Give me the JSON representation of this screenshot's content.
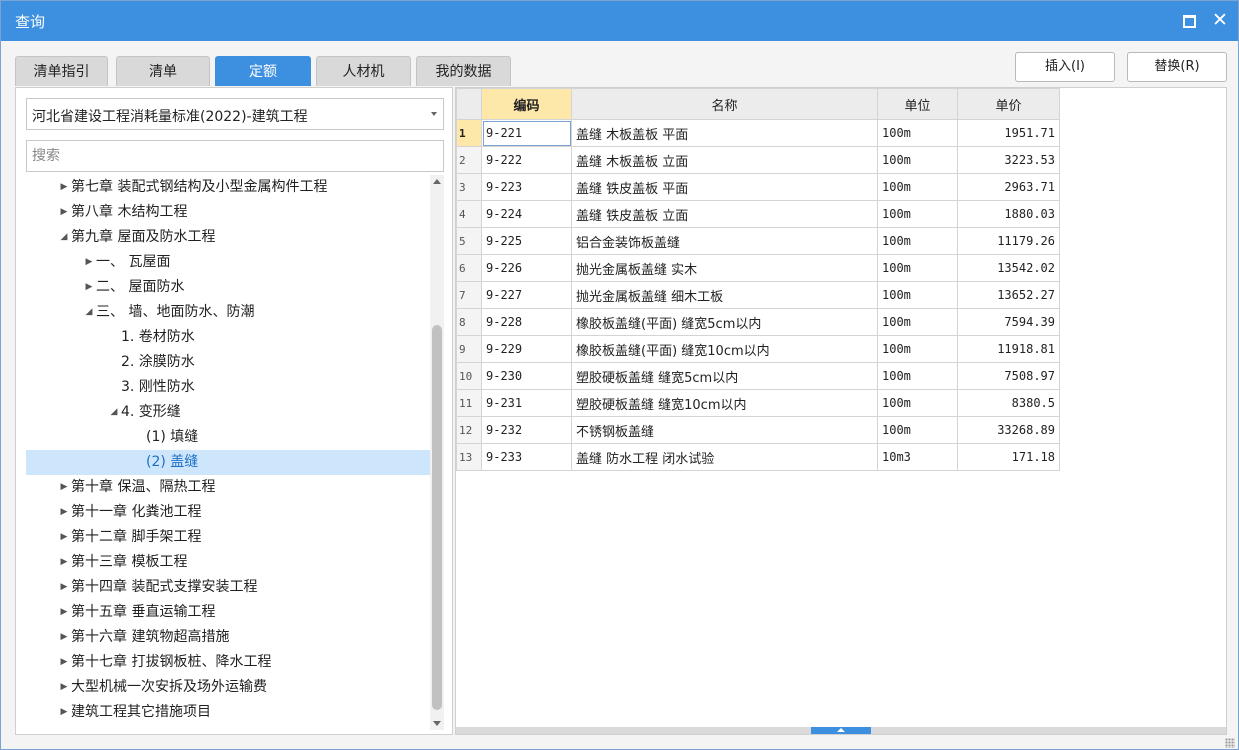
{
  "window": {
    "title": "查询"
  },
  "tabs": [
    {
      "label": "清单指引",
      "active": false
    },
    {
      "label": "清单",
      "active": false
    },
    {
      "label": "定额",
      "active": true
    },
    {
      "label": "人材机",
      "active": false
    },
    {
      "label": "我的数据",
      "active": false
    }
  ],
  "actions": {
    "insert_label": "插入(I)",
    "replace_label": "替换(R)"
  },
  "library": {
    "selected": "河北省建设工程消耗量标准(2022)-建筑工程"
  },
  "search": {
    "placeholder": "搜索",
    "value": ""
  },
  "tree": [
    {
      "label": "第七章 装配式钢结构及小型金属构件工程",
      "level": 0,
      "state": "collapsed",
      "selected": false
    },
    {
      "label": "第八章 木结构工程",
      "level": 0,
      "state": "collapsed",
      "selected": false
    },
    {
      "label": "第九章 屋面及防水工程",
      "level": 0,
      "state": "expanded",
      "selected": false
    },
    {
      "label": "一、 瓦屋面",
      "level": 1,
      "state": "collapsed",
      "selected": false
    },
    {
      "label": "二、 屋面防水",
      "level": 1,
      "state": "collapsed",
      "selected": false
    },
    {
      "label": "三、 墙、地面防水、防潮",
      "level": 1,
      "state": "expanded",
      "selected": false
    },
    {
      "label": "1. 卷材防水",
      "level": 2,
      "state": "leaf",
      "selected": false
    },
    {
      "label": "2. 涂膜防水",
      "level": 2,
      "state": "leaf",
      "selected": false
    },
    {
      "label": "3. 刚性防水",
      "level": 2,
      "state": "leaf",
      "selected": false
    },
    {
      "label": "4. 变形缝",
      "level": 2,
      "state": "expanded",
      "selected": false
    },
    {
      "label": "(1) 填缝",
      "level": 3,
      "state": "leaf",
      "selected": false
    },
    {
      "label": "(2) 盖缝",
      "level": 3,
      "state": "leaf",
      "selected": true
    },
    {
      "label": "第十章 保温、隔热工程",
      "level": 0,
      "state": "collapsed",
      "selected": false
    },
    {
      "label": "第十一章 化粪池工程",
      "level": 0,
      "state": "collapsed",
      "selected": false
    },
    {
      "label": "第十二章 脚手架工程",
      "level": 0,
      "state": "collapsed",
      "selected": false
    },
    {
      "label": "第十三章 模板工程",
      "level": 0,
      "state": "collapsed",
      "selected": false
    },
    {
      "label": "第十四章 装配式支撑安装工程",
      "level": 0,
      "state": "collapsed",
      "selected": false
    },
    {
      "label": "第十五章 垂直运输工程",
      "level": 0,
      "state": "collapsed",
      "selected": false
    },
    {
      "label": "第十六章 建筑物超高措施",
      "level": 0,
      "state": "collapsed",
      "selected": false
    },
    {
      "label": "第十七章 打拔钢板桩、降水工程",
      "level": 0,
      "state": "collapsed",
      "selected": false
    },
    {
      "label": "大型机械一次安拆及场外运输费",
      "level": 0,
      "state": "collapsed",
      "selected": false
    },
    {
      "label": "建筑工程其它措施项目",
      "level": 0,
      "state": "collapsed",
      "selected": false
    }
  ],
  "table": {
    "columns": [
      "编码",
      "名称",
      "单位",
      "单价"
    ],
    "rows": [
      {
        "idx": "1",
        "code": "9-221",
        "name": "盖缝 木板盖板 平面",
        "unit": "100m",
        "price": "1951.71"
      },
      {
        "idx": "2",
        "code": "9-222",
        "name": "盖缝 木板盖板 立面",
        "unit": "100m",
        "price": "3223.53"
      },
      {
        "idx": "3",
        "code": "9-223",
        "name": "盖缝 铁皮盖板 平面",
        "unit": "100m",
        "price": "2963.71"
      },
      {
        "idx": "4",
        "code": "9-224",
        "name": "盖缝 铁皮盖板 立面",
        "unit": "100m",
        "price": "1880.03"
      },
      {
        "idx": "5",
        "code": "9-225",
        "name": "铝合金装饰板盖缝",
        "unit": "100m",
        "price": "11179.26"
      },
      {
        "idx": "6",
        "code": "9-226",
        "name": "抛光金属板盖缝 实木",
        "unit": "100m",
        "price": "13542.02"
      },
      {
        "idx": "7",
        "code": "9-227",
        "name": "抛光金属板盖缝 细木工板",
        "unit": "100m",
        "price": "13652.27"
      },
      {
        "idx": "8",
        "code": "9-228",
        "name": "橡胶板盖缝(平面) 缝宽5cm以内",
        "unit": "100m",
        "price": "7594.39"
      },
      {
        "idx": "9",
        "code": "9-229",
        "name": "橡胶板盖缝(平面) 缝宽10cm以内",
        "unit": "100m",
        "price": "11918.81"
      },
      {
        "idx": "10",
        "code": "9-230",
        "name": "塑胶硬板盖缝 缝宽5cm以内",
        "unit": "100m",
        "price": "7508.97"
      },
      {
        "idx": "11",
        "code": "9-231",
        "name": "塑胶硬板盖缝 缝宽10cm以内",
        "unit": "100m",
        "price": "8380.5"
      },
      {
        "idx": "12",
        "code": "9-232",
        "name": "不锈钢板盖缝",
        "unit": "100m",
        "price": "33268.89"
      },
      {
        "idx": "13",
        "code": "9-233",
        "name": "盖缝 防水工程 闭水试验",
        "unit": "10m3",
        "price": "171.18"
      }
    ]
  },
  "colors": {
    "accent": "#3d8fe0",
    "selected_row": "#cde6fb",
    "header_highlight": "#fde7a9"
  }
}
